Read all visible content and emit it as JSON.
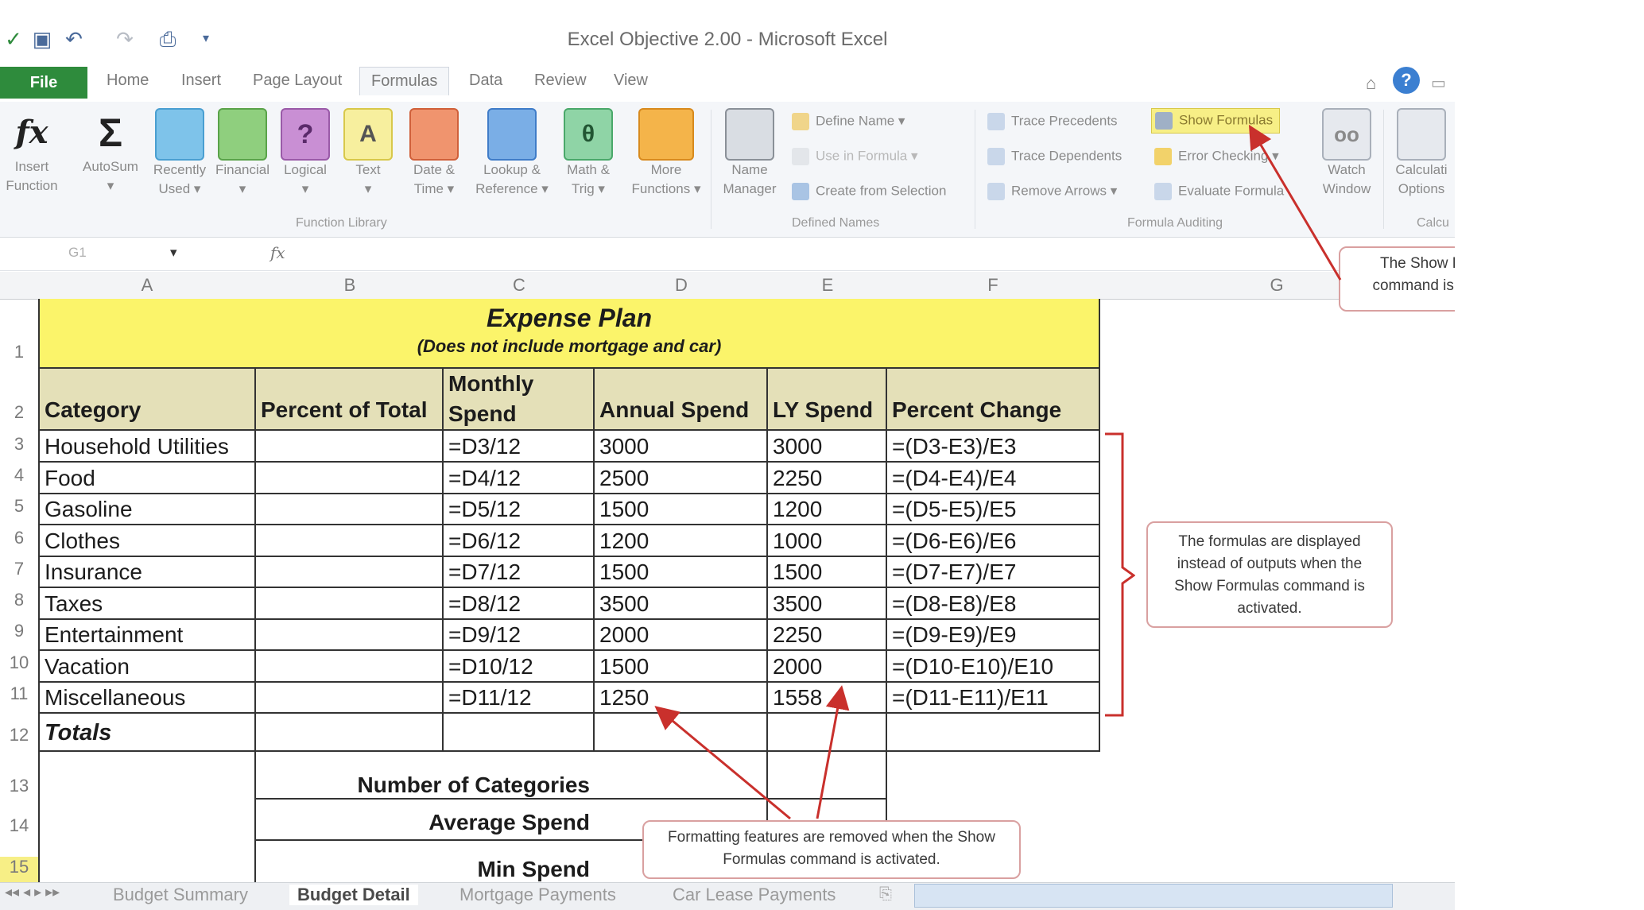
{
  "window": {
    "title": "Excel Objective 2.00 - Microsoft Excel"
  },
  "ribbon_tabs": [
    "File",
    "Home",
    "Insert",
    "Page Layout",
    "Formulas",
    "Data",
    "Review",
    "View"
  ],
  "function_library": {
    "buttons": [
      {
        "line1": "Insert",
        "line2": "Function",
        "icon": "fx-icon"
      },
      {
        "line1": "AutoSum",
        "line2": "▾",
        "icon": "sigma-icon"
      },
      {
        "line1": "Recently",
        "line2": "Used ▾",
        "icon": "book-icon"
      },
      {
        "line1": "Financial",
        "line2": "▾",
        "icon": "book-icon"
      },
      {
        "line1": "Logical",
        "line2": "▾",
        "icon": "book-icon"
      },
      {
        "line1": "Text",
        "line2": "▾",
        "icon": "book-icon"
      },
      {
        "line1": "Date &",
        "line2": "Time ▾",
        "icon": "book-icon"
      },
      {
        "line1": "Lookup &",
        "line2": "Reference ▾",
        "icon": "book-icon"
      },
      {
        "line1": "Math &",
        "line2": "Trig ▾",
        "icon": "book-icon"
      },
      {
        "line1": "More",
        "line2": "Functions ▾",
        "icon": "book-icon"
      }
    ],
    "label": "Function Library"
  },
  "defined_names": {
    "name_manager": {
      "line1": "Name",
      "line2": "Manager"
    },
    "define_name": "Define Name ▾",
    "use_in_formula": "Use in Formula ▾",
    "create_from_selection": "Create from Selection",
    "label": "Defined Names"
  },
  "formula_auditing": {
    "trace_precedents": "Trace Precedents",
    "trace_dependents": "Trace Dependents",
    "remove_arrows": "Remove Arrows ▾",
    "show_formulas": "Show Formulas",
    "error_checking": "Error Checking ▾",
    "evaluate_formula": "Evaluate Formula",
    "watch_window": {
      "line1": "Watch",
      "line2": "Window"
    },
    "label": "Formula Auditing"
  },
  "calculation": {
    "options": {
      "line1": "Calculati",
      "line2": "Options"
    },
    "label": "Calcu"
  },
  "formula_bar": {
    "name_box": "G1",
    "fx": "fx",
    "content": ""
  },
  "columns": [
    "A",
    "B",
    "C",
    "D",
    "E",
    "F",
    "G"
  ],
  "sheet": {
    "title": "Expense Plan",
    "subtitle": "(Does not include mortgage and car)",
    "headers": {
      "category": "Category",
      "percent_of_total": "Percent of Total",
      "monthly_1": "Monthly",
      "monthly_2": "Spend",
      "annual": "Annual Spend",
      "ly": "LY Spend",
      "change": "Percent Change"
    },
    "rows": [
      {
        "n": "3",
        "category": "Household Utilities",
        "percent": "",
        "monthly": "=D3/12",
        "annual": "3000",
        "ly": "3000",
        "change": "=(D3-E3)/E3"
      },
      {
        "n": "4",
        "category": "Food",
        "percent": "",
        "monthly": "=D4/12",
        "annual": "2500",
        "ly": "2250",
        "change": "=(D4-E4)/E4"
      },
      {
        "n": "5",
        "category": "Gasoline",
        "percent": "",
        "monthly": "=D5/12",
        "annual": "1500",
        "ly": "1200",
        "change": "=(D5-E5)/E5"
      },
      {
        "n": "6",
        "category": "Clothes",
        "percent": "",
        "monthly": "=D6/12",
        "annual": "1200",
        "ly": "1000",
        "change": "=(D6-E6)/E6"
      },
      {
        "n": "7",
        "category": "Insurance",
        "percent": "",
        "monthly": "=D7/12",
        "annual": "1500",
        "ly": "1500",
        "change": "=(D7-E7)/E7"
      },
      {
        "n": "8",
        "category": "Taxes",
        "percent": "",
        "monthly": "=D8/12",
        "annual": "3500",
        "ly": "3500",
        "change": "=(D8-E8)/E8"
      },
      {
        "n": "9",
        "category": "Entertainment",
        "percent": "",
        "monthly": "=D9/12",
        "annual": "2000",
        "ly": "2250",
        "change": "=(D9-E9)/E9"
      },
      {
        "n": "10",
        "category": "Vacation",
        "percent": "",
        "monthly": "=D10/12",
        "annual": "1500",
        "ly": "2000",
        "change": "=(D10-E10)/E10"
      },
      {
        "n": "11",
        "category": "Miscellaneous",
        "percent": "",
        "monthly": "=D11/12",
        "annual": "1250",
        "ly": "1558",
        "change": "=(D11-E11)/E11"
      }
    ],
    "totals": "Totals",
    "number_of_categories": "Number of Categories",
    "average_spend": "Average Spend",
    "min_spend": "Min Spend"
  },
  "row_numbers": [
    "1",
    "2",
    "3",
    "4",
    "5",
    "6",
    "7",
    "8",
    "9",
    "10",
    "11",
    "12",
    "13",
    "14",
    "15"
  ],
  "callouts": {
    "show_formulas": "The Show Formulas command is activated.",
    "formulas_displayed": "The formulas are displayed instead of outputs when the Show Formulas command is activated.",
    "formatting_removed": "Formatting features are removed when the Show Formulas command is activated."
  },
  "sheet_tabs": [
    "Budget Summary",
    "Budget Detail",
    "Mortgage Payments",
    "Car Lease Payments"
  ],
  "active_sheet": "Budget Detail",
  "colors": {
    "title_fill": "#fbf46a",
    "header_fill": "#e4e0b8",
    "file_tab": "#2e8b3c",
    "callout_arrow": "#c9302c",
    "highlight": "#f7ef86"
  }
}
